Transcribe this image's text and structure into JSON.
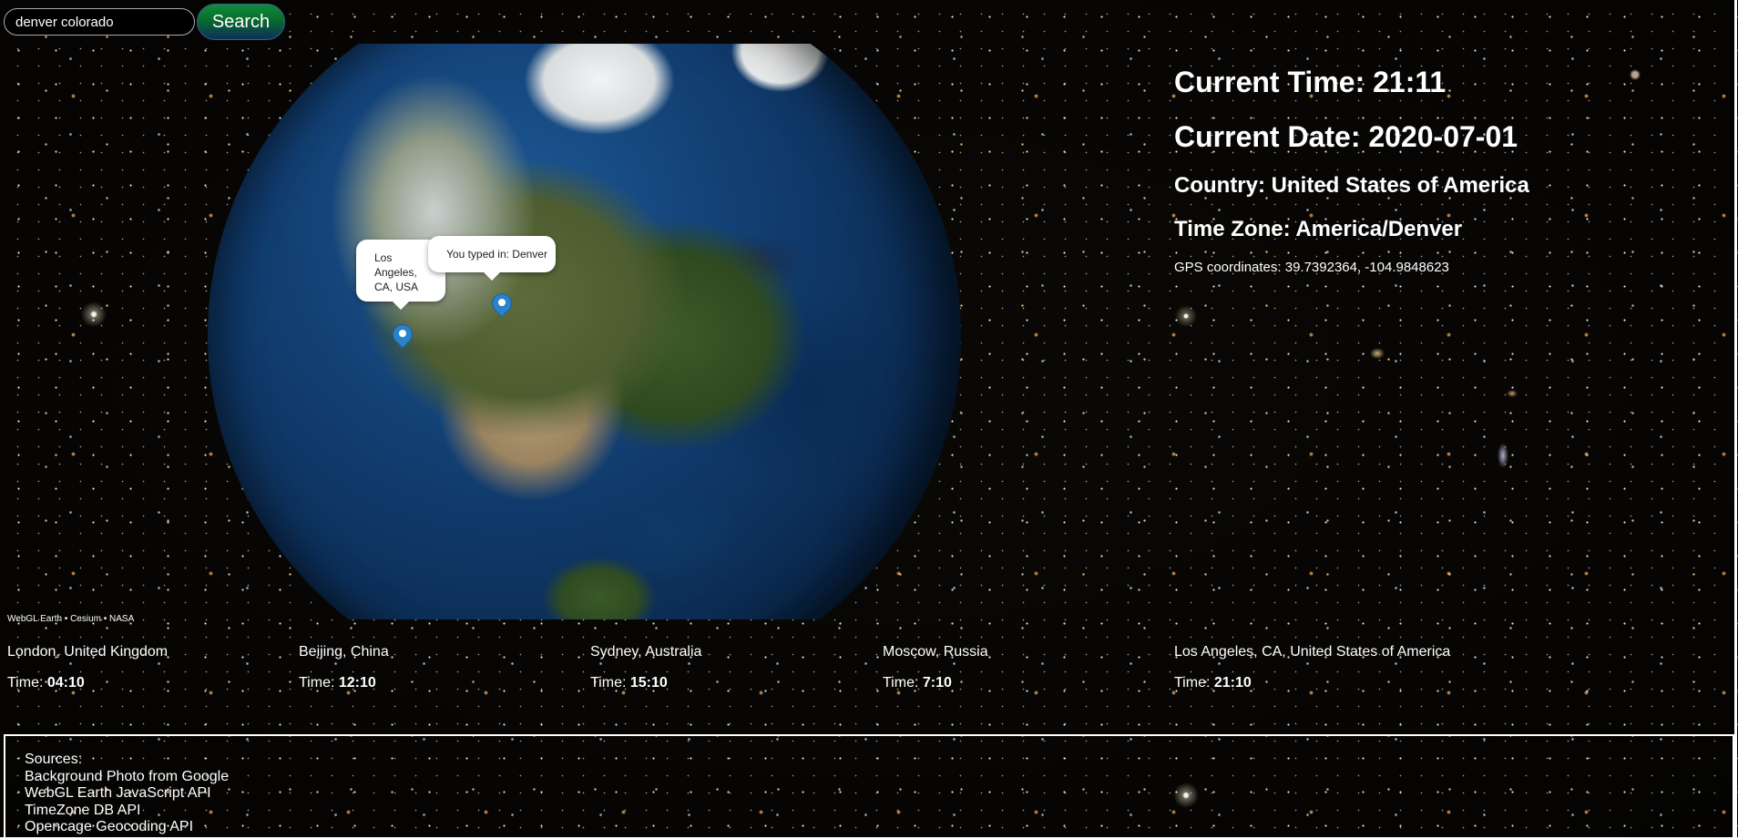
{
  "search": {
    "value": "denver colorado",
    "button_label": "Search"
  },
  "globe": {
    "credit": "WebGL Earth • Cesium • NASA",
    "markers": [
      {
        "icon": "map-pin-icon",
        "popup": "You typed in: Denver"
      },
      {
        "icon": "map-pin-icon",
        "popup": "Los Angeles, CA, USA"
      }
    ],
    "colors": {
      "marker": "#2a82c9",
      "ocean": "#123f73",
      "land": "#4d5d2f"
    }
  },
  "info": {
    "current_time": "Current Time: 21:11",
    "current_date": "Current Date: 2020-07-01",
    "country": "Country: United States of America",
    "time_zone": "Time Zone: America/Denver",
    "gps": "GPS coordinates: 39.7392364, -104.9848623"
  },
  "cities": [
    {
      "name": "London, United Kingdom",
      "time_label": "Time: ",
      "time": "04:10"
    },
    {
      "name": "Beijing, China",
      "time_label": "Time: ",
      "time": "12:10"
    },
    {
      "name": "Sydney, Australia",
      "time_label": "Time: ",
      "time": "15:10"
    },
    {
      "name": "Moscow, Russia",
      "time_label": "Time: ",
      "time": "7:10"
    },
    {
      "name": "Los Angeles, CA, United States of America",
      "time_label": "Time: ",
      "time": "21:10"
    }
  ],
  "sources": {
    "heading": "Sources:",
    "items": [
      "Background Photo from Google",
      "WebGL Earth JavaScript API",
      "TimeZone DB API",
      "Opencage Geocoding API"
    ]
  },
  "colors": {
    "search_button_top": "#0e8c3a",
    "search_button_bottom": "#0b2f5a",
    "text": "#ffffff",
    "background": "#040302"
  }
}
